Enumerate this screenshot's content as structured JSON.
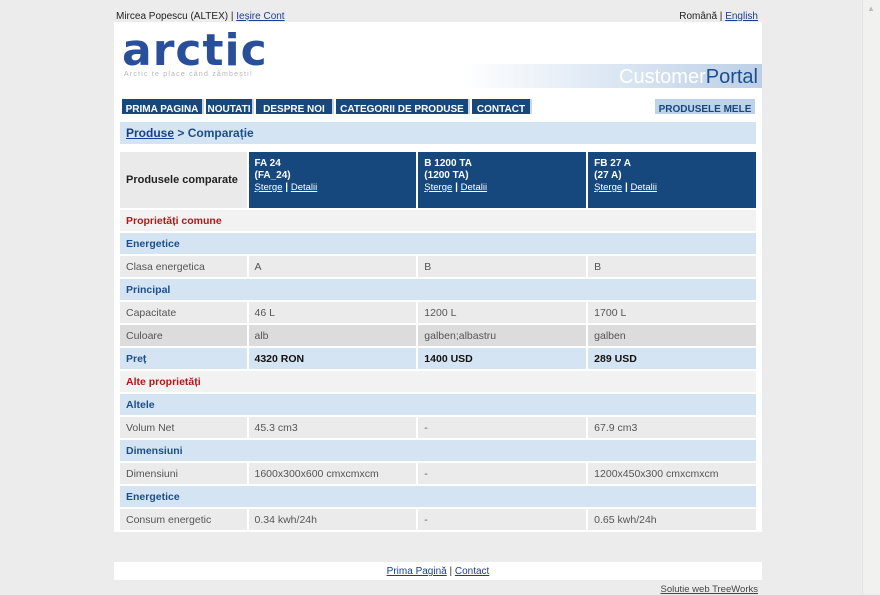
{
  "topbar": {
    "user": "Mircea Popescu (ALTEX) |",
    "logout": "Ieșire Cont",
    "lang_current": "Română |",
    "lang_other": "English"
  },
  "header": {
    "logo": "arctic",
    "tagline": "Arctic te place când zâmbești!",
    "portal_part1": "Customer",
    "portal_part2": "Portal"
  },
  "nav": {
    "items": [
      "PRIMA PAGINA",
      "NOUTATI",
      "DESPRE NOI",
      "CATEGORII DE PRODUSE",
      "CONTACT"
    ],
    "mine": "PRODUSELE MELE"
  },
  "breadcrumb": {
    "link": "Produse",
    "current": " > Comparație"
  },
  "compare": {
    "label": "Produsele comparate",
    "delete_label": "Șterge",
    "details_label": "Detalii",
    "products": [
      {
        "name": "FA 24",
        "code": "(FA_24)"
      },
      {
        "name": "B 1200 TA",
        "code": "(1200 TA)"
      },
      {
        "name": "FB 27 A",
        "code": "(27 A)"
      }
    ],
    "rows": [
      {
        "kind": "section",
        "label": "Proprietăți comune"
      },
      {
        "kind": "group",
        "label": "Energetice"
      },
      {
        "kind": "row",
        "label": "Clasa energetica",
        "values": [
          "A",
          "B",
          "B"
        ]
      },
      {
        "kind": "group",
        "label": "Principal"
      },
      {
        "kind": "row",
        "label": "Capacitate",
        "values": [
          "46 L",
          "1200 L",
          "1700 L"
        ]
      },
      {
        "kind": "row alt",
        "label": "Culoare",
        "values": [
          "alb",
          "galben;albastru",
          "galben"
        ]
      },
      {
        "kind": "price",
        "label": "Preț",
        "values": [
          "4320 RON",
          "1400 USD",
          "289 USD"
        ]
      },
      {
        "kind": "section",
        "label": "Alte proprietăți"
      },
      {
        "kind": "group",
        "label": "Altele"
      },
      {
        "kind": "row",
        "label": "Volum Net",
        "values": [
          "45.3 cm3",
          "-",
          "67.9 cm3"
        ]
      },
      {
        "kind": "group",
        "label": "Dimensiuni"
      },
      {
        "kind": "row",
        "label": "Dimensiuni",
        "values": [
          "1600x300x600 cmxcmxcm",
          "-",
          "1200x450x300 cmxcmxcm"
        ]
      },
      {
        "kind": "group",
        "label": "Energetice"
      },
      {
        "kind": "row",
        "label": "Consum energetic",
        "values": [
          "0.34 kwh/24h",
          "-",
          "0.65 kwh/24h"
        ]
      }
    ]
  },
  "footer": {
    "home": "Prima Pagină",
    "sep": " | ",
    "contact": "Contact"
  },
  "credit": "Solutie web TreeWorks"
}
